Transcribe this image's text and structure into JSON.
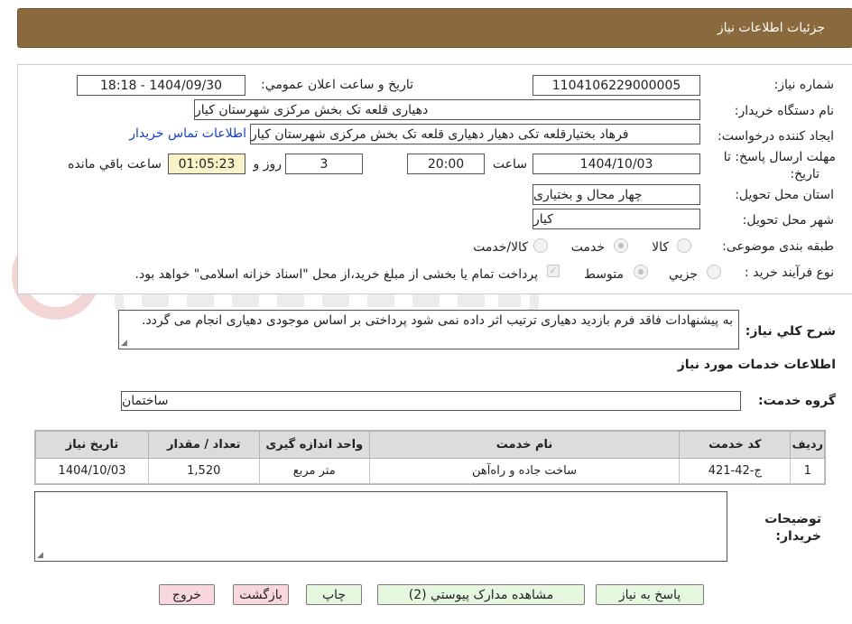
{
  "header": {
    "title": "جزئیات اطلاعات نیاز"
  },
  "form": {
    "need_number_label": "شماره نیاز:",
    "need_number": "1104106229000005",
    "announce_label": "تاریخ و ساعت اعلان عمومي:",
    "announce_value": "1404/09/30 - 18:18",
    "buyer_org_label": "نام دستگاه خریدار:",
    "buyer_org": "دهیاری قلعه تک بخش مرکزی شهرستان کیار",
    "requester_label": "ایجاد کننده درخواست:",
    "requester": "فرهاد بختیارقلعه تکی دهیار دهیاری قلعه تک بخش مرکزی شهرستان کیار",
    "contact_link": "اطلاعات تماس خریدار",
    "deadline_label_1": "مهلت ارسال پاسخ: تا",
    "deadline_label_2": "تاریخ:",
    "deadline_date": "1404/10/03",
    "time_label": "ساعت",
    "deadline_time": "20:00",
    "days_value": "3",
    "days_label": "روز و",
    "remaining_time": "01:05:23",
    "remaining_label": "ساعت باقي مانده",
    "province_label": "استان محل تحویل:",
    "province": "چهار محال و بختیاری",
    "city_label": "شهر محل تحویل:",
    "city": "کیار",
    "category_label": "طبقه بندی موضوعی:",
    "category_options": [
      "کالا",
      "خدمت",
      "کالا/خدمت"
    ],
    "process_label": "نوع فرآیند خرید :",
    "process_options": [
      "جزيي",
      "متوسط"
    ],
    "payment_note": "پرداخت تمام یا بخشی از مبلغ خرید،از محل \"اسناد خزانه اسلامی\" خواهد بود."
  },
  "description": {
    "label": "شرح کلي نیاز:",
    "text": "به پیشنهادات فاقد فرم بازدید دهیاری ترتیب اثر داده نمی شود پرداختی بر اساس موجودی دهیاری انجام می گردد."
  },
  "services": {
    "section_title": "اطلاعات خدمات مورد نیاز",
    "group_label": "گروه خدمت:",
    "group_value": "ساختمان",
    "columns": [
      "ردیف",
      "کد خدمت",
      "نام خدمت",
      "واحد اندازه گیری",
      "تعداد / مقدار",
      "تاریخ نیاز"
    ],
    "rows": [
      [
        "1",
        "ج-42-421",
        "ساخت جاده و راه‌آهن",
        "متر مربع",
        "1,520",
        "1404/10/03"
      ]
    ]
  },
  "buyer_notes": {
    "label_1": "توضیحات",
    "label_2": "خریدار:",
    "text": ""
  },
  "buttons": {
    "reply": "پاسخ به نیاز",
    "attachments": "مشاهده مدارک پیوستي (2)",
    "print": "چاپ",
    "back": "بازگشت",
    "exit": "خروج"
  },
  "colors": {
    "header_bg": "#8a6a3c",
    "link": "#1a40c8",
    "remaining_bg": "#f7f2c7"
  }
}
